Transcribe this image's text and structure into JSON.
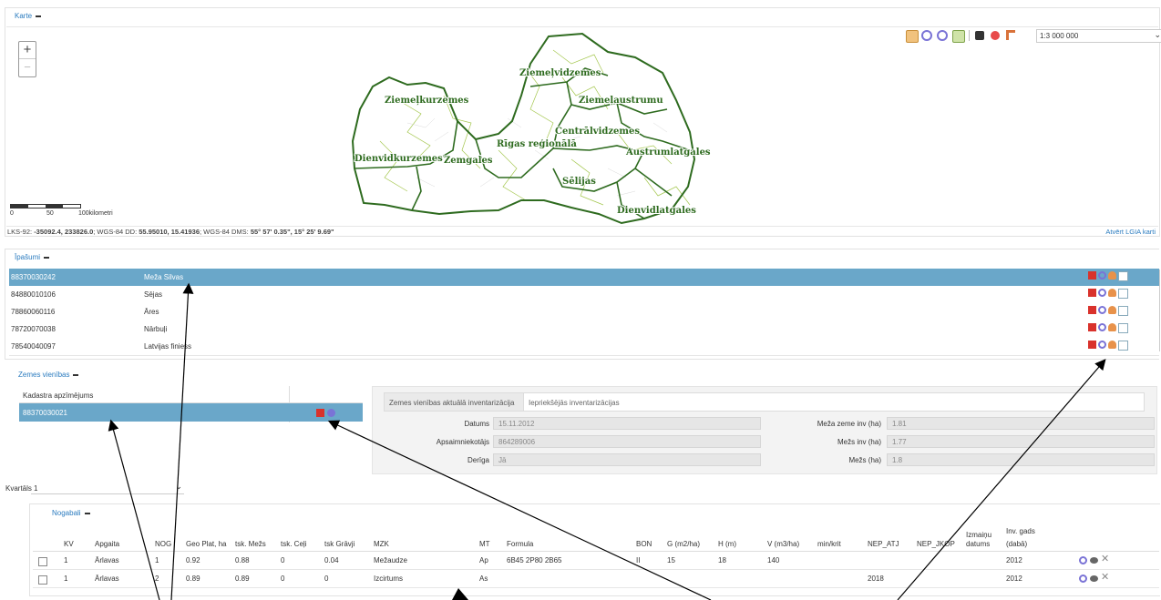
{
  "map_panel": {
    "title": "Karte",
    "scale_select": "1:3 000 000",
    "scale_bar": {
      "t0": "0",
      "t1": "50",
      "t2": "100kilometri"
    },
    "zoom_in": "+",
    "zoom_out": "−",
    "coords": {
      "lks_label": "LKS-92: ",
      "lks_value": "-35092.4, 233826.0",
      "wgs_label": "; WGS-84 DD: ",
      "wgs_value": "55.95010, 15.41936",
      "dms_label": "; WGS-84 DMS: ",
      "dms_value": "55° 57' 0.35\", 15° 25' 9.69\""
    },
    "open_lgia": "Atvērt LGIA karti",
    "regions": [
      "Ziemeļvidzemes",
      "Ziemeļkurzemes",
      "Ziemeļaustrumu",
      "Centrālvidzemes",
      "Rīgas reģionālā",
      "Austrumlatgales",
      "Dienvidkurzemes",
      "Zemgales",
      "Sēlijas",
      "Dienvidlatgales"
    ],
    "colors": {
      "border_dark": "#2e6b1f",
      "border_light": "#9bc13c",
      "label": "#2e6b1f"
    }
  },
  "properties_panel": {
    "title": "Īpašumi",
    "rows": [
      {
        "code": "88370030242",
        "name": "Meža Silvas",
        "selected": true
      },
      {
        "code": "84880010106",
        "name": "Sējas",
        "selected": false
      },
      {
        "code": "78860060116",
        "name": "Āres",
        "selected": false
      },
      {
        "code": "78720070038",
        "name": "Nārbuļi",
        "selected": false
      },
      {
        "code": "78540040097",
        "name": "Latvijas finiess",
        "selected": false
      }
    ]
  },
  "land_units": {
    "title": "Zemes vienības",
    "col_header": "Kadastra apzīmējums",
    "row_code": "88370030021",
    "tabs": [
      "Zemes vienības aktuālā inventarizācija",
      "Iepriekšējās inventarizācijas"
    ],
    "fields_left": [
      {
        "label": "Datums",
        "value": "15.11.2012"
      },
      {
        "label": "Apsaimniekotājs",
        "value": "864289006"
      },
      {
        "label": "Derīga",
        "value": "Jā"
      }
    ],
    "fields_right": [
      {
        "label": "Meža zeme inv (ha)",
        "value": "1.81"
      },
      {
        "label": "Mežs inv (ha)",
        "value": "1.77"
      },
      {
        "label": "Mežs (ha)",
        "value": "1.8"
      }
    ]
  },
  "quarter": {
    "label": "Kvartāls",
    "value": "1"
  },
  "nogabali": {
    "title": "Nogabali",
    "headers": {
      "kv": "KV",
      "apgaita": "Apgaita",
      "nog": "NOG",
      "geo": "Geo Plat, ha",
      "mezs": "tsk. Mežs",
      "celi": "tsk. Ceļi",
      "gravji": "tsk Grāvji",
      "mzk": "MZK",
      "mt": "MT",
      "formula": "Formula",
      "bon": "BON",
      "g": "G (m2/ha)",
      "h": "H (m)",
      "v": "V (m3/ha)",
      "minkrit": "min/krit",
      "nep_atj": "NEP_ATJ",
      "nep_jkop": "NEP_JKOP",
      "izm1": "Izmaiņu",
      "izm2": "datums",
      "inv1": "Inv. gads",
      "inv2": "(dabā)"
    },
    "rows": [
      {
        "kv": "1",
        "apgaita": "Ārlavas",
        "nog": "1",
        "geo": "0.92",
        "mezs": "0.88",
        "celi": "0",
        "gravji": "0.04",
        "mzk": "Mežaudze",
        "mt": "Ap",
        "formula": "6B45 2P80 2B65",
        "bon": "II",
        "g": "15",
        "h": "18",
        "v": "140",
        "minkrit": "",
        "nep_atj": "",
        "nep_jkop": "",
        "izm": "",
        "inv": "2012"
      },
      {
        "kv": "1",
        "apgaita": "Ārlavas",
        "nog": "2",
        "geo": "0.89",
        "mezs": "0.89",
        "celi": "0",
        "gravji": "0",
        "mzk": "Izcirtums",
        "mt": "As",
        "formula": "",
        "bon": "",
        "g": "",
        "h": "",
        "v": "",
        "minkrit": "",
        "nep_atj": "2018",
        "nep_jkop": "",
        "izm": "",
        "inv": "2012"
      }
    ]
  }
}
